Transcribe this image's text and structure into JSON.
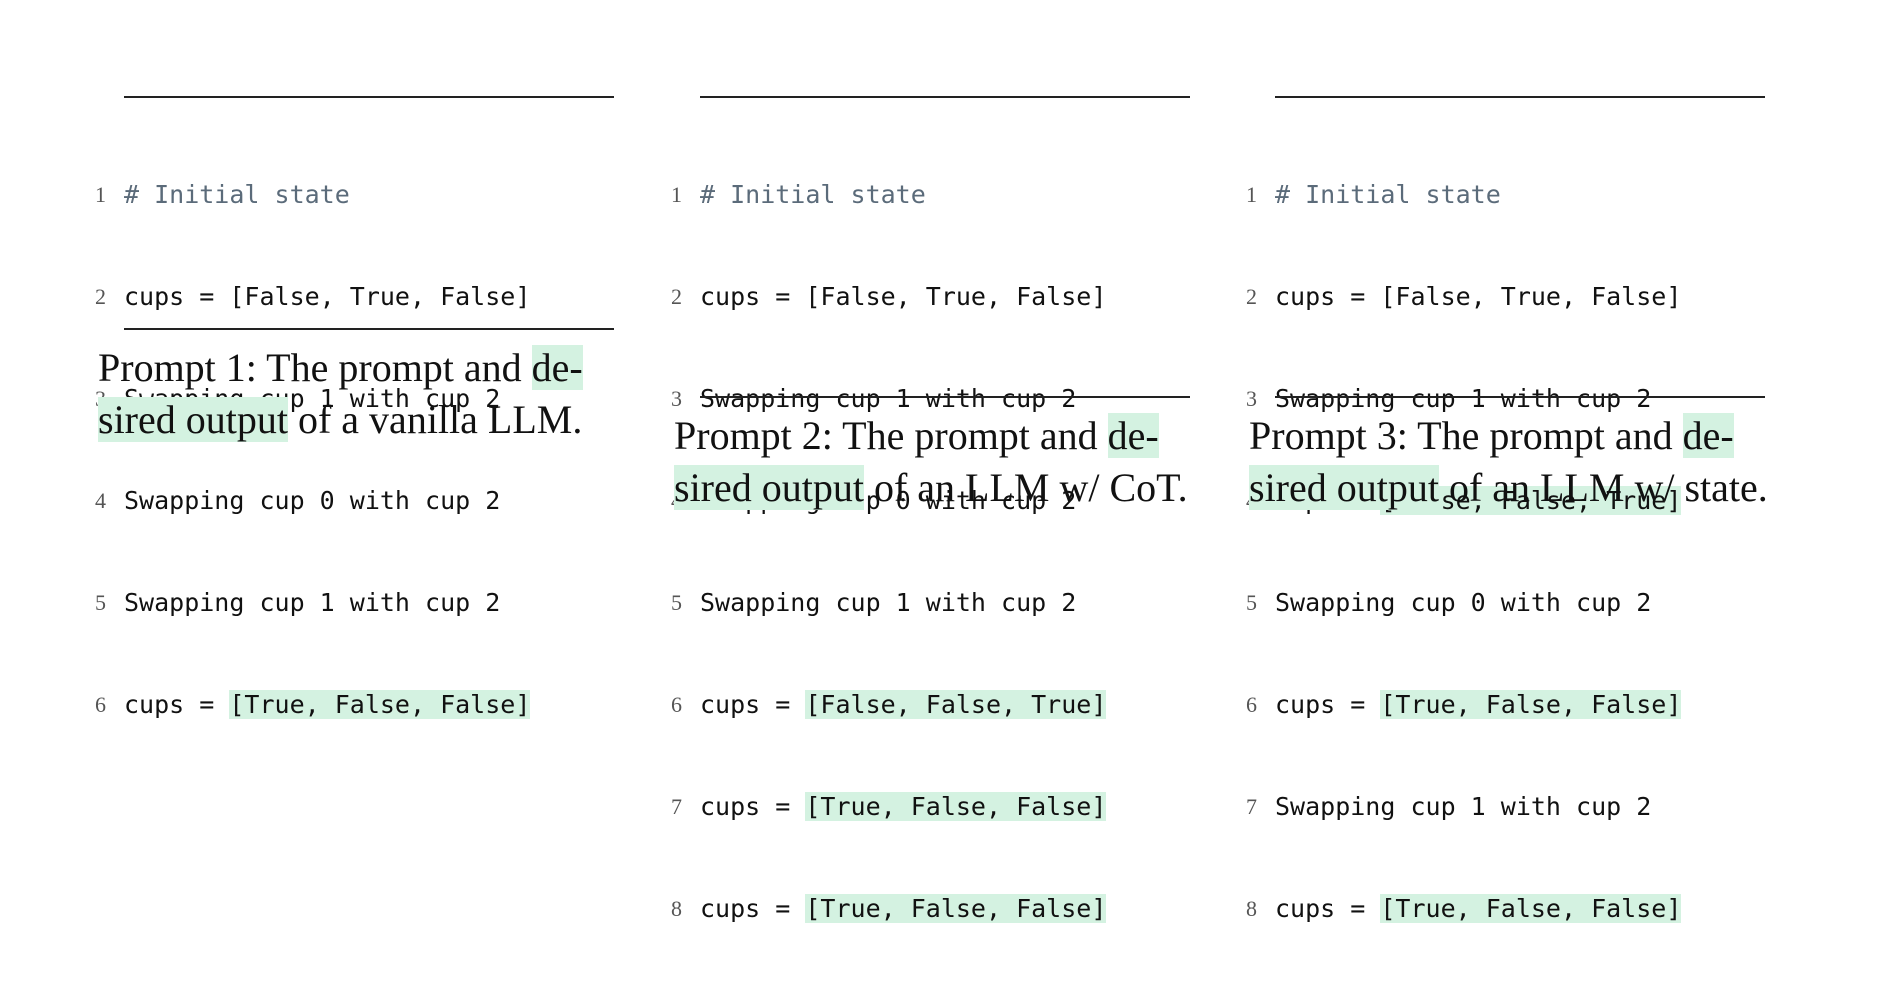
{
  "panels": [
    {
      "lines": [
        {
          "n": "1",
          "prefix": "# Initial state",
          "hl": "",
          "comment": true
        },
        {
          "n": "2",
          "prefix": "cups = [False, True, False]",
          "hl": ""
        },
        {
          "n": "3",
          "prefix": "Swapping cup 1 with cup 2",
          "hl": ""
        },
        {
          "n": "4",
          "prefix": "Swapping cup 0 with cup 2",
          "hl": ""
        },
        {
          "n": "5",
          "prefix": "Swapping cup 1 with cup 2",
          "hl": ""
        },
        {
          "n": "6",
          "prefix": "cups = ",
          "hl": "[True, False, False]"
        }
      ],
      "caption": {
        "lead": "Prompt 1:",
        "pre": " The prompt and ",
        "hl1": "de-",
        "hl2": "sired output",
        "post": " of a vanilla LLM."
      }
    },
    {
      "lines": [
        {
          "n": "1",
          "prefix": "# Initial state",
          "hl": "",
          "comment": true
        },
        {
          "n": "2",
          "prefix": "cups = [False, True, False]",
          "hl": ""
        },
        {
          "n": "3",
          "prefix": "Swapping cup 1 with cup 2",
          "hl": ""
        },
        {
          "n": "4",
          "prefix": "Swapping cup 0 with cup 2",
          "hl": ""
        },
        {
          "n": "5",
          "prefix": "Swapping cup 1 with cup 2",
          "hl": ""
        },
        {
          "n": "6",
          "prefix": "cups = ",
          "hl": "[False, False, True]"
        },
        {
          "n": "7",
          "prefix": "cups = ",
          "hl": "[True, False, False]"
        },
        {
          "n": "8",
          "prefix": "cups = ",
          "hl": "[True, False, False]"
        }
      ],
      "caption": {
        "lead": "Prompt 2:",
        "pre": " The prompt and ",
        "hl1": "de-",
        "hl2": "sired output",
        "post": " of an LLM w/ CoT."
      }
    },
    {
      "lines": [
        {
          "n": "1",
          "prefix": "# Initial state",
          "hl": "",
          "comment": true
        },
        {
          "n": "2",
          "prefix": "cups = [False, True, False]",
          "hl": ""
        },
        {
          "n": "3",
          "prefix": "Swapping cup 1 with cup 2",
          "hl": ""
        },
        {
          "n": "4",
          "prefix": "cups = ",
          "hl": "[False, False, True]"
        },
        {
          "n": "5",
          "prefix": "Swapping cup 0 with cup 2",
          "hl": ""
        },
        {
          "n": "6",
          "prefix": "cups = ",
          "hl": "[True, False, False]"
        },
        {
          "n": "7",
          "prefix": "Swapping cup 1 with cup 2",
          "hl": ""
        },
        {
          "n": "8",
          "prefix": "cups = ",
          "hl": "[True, False, False]"
        }
      ],
      "caption": {
        "lead": "Prompt 3:",
        "pre": " The prompt and ",
        "hl1": "de-",
        "hl2": "sired output",
        "post": " of an LLM w/ state."
      }
    }
  ]
}
